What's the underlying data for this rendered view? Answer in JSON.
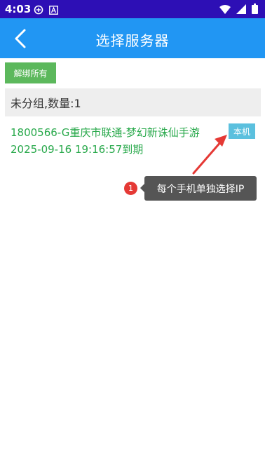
{
  "status_bar": {
    "time": "4:03",
    "left_icons": [
      "settings-circle-icon",
      "a-box-icon"
    ],
    "right_icons": [
      "wifi-icon",
      "signal-icon",
      "battery-icon"
    ]
  },
  "app_bar": {
    "title": "选择服务器",
    "back_icon": "chevron-left-icon",
    "background": "#2196f3"
  },
  "unbind_button": {
    "label": "解绑所有",
    "color": "#5cb85c"
  },
  "group": {
    "header": "未分组,数量:1",
    "servers": [
      {
        "name": "1800566-G重庆市联通-梦幻新诛仙手游",
        "expire": "2025-09-16 19:16:57到期",
        "badge": "本机",
        "text_color": "#27a84a",
        "badge_color": "#5bc0de"
      }
    ]
  },
  "annotation": {
    "step": "1",
    "tooltip": "每个手机单独选择IP",
    "arrow_color": "#e53935"
  }
}
